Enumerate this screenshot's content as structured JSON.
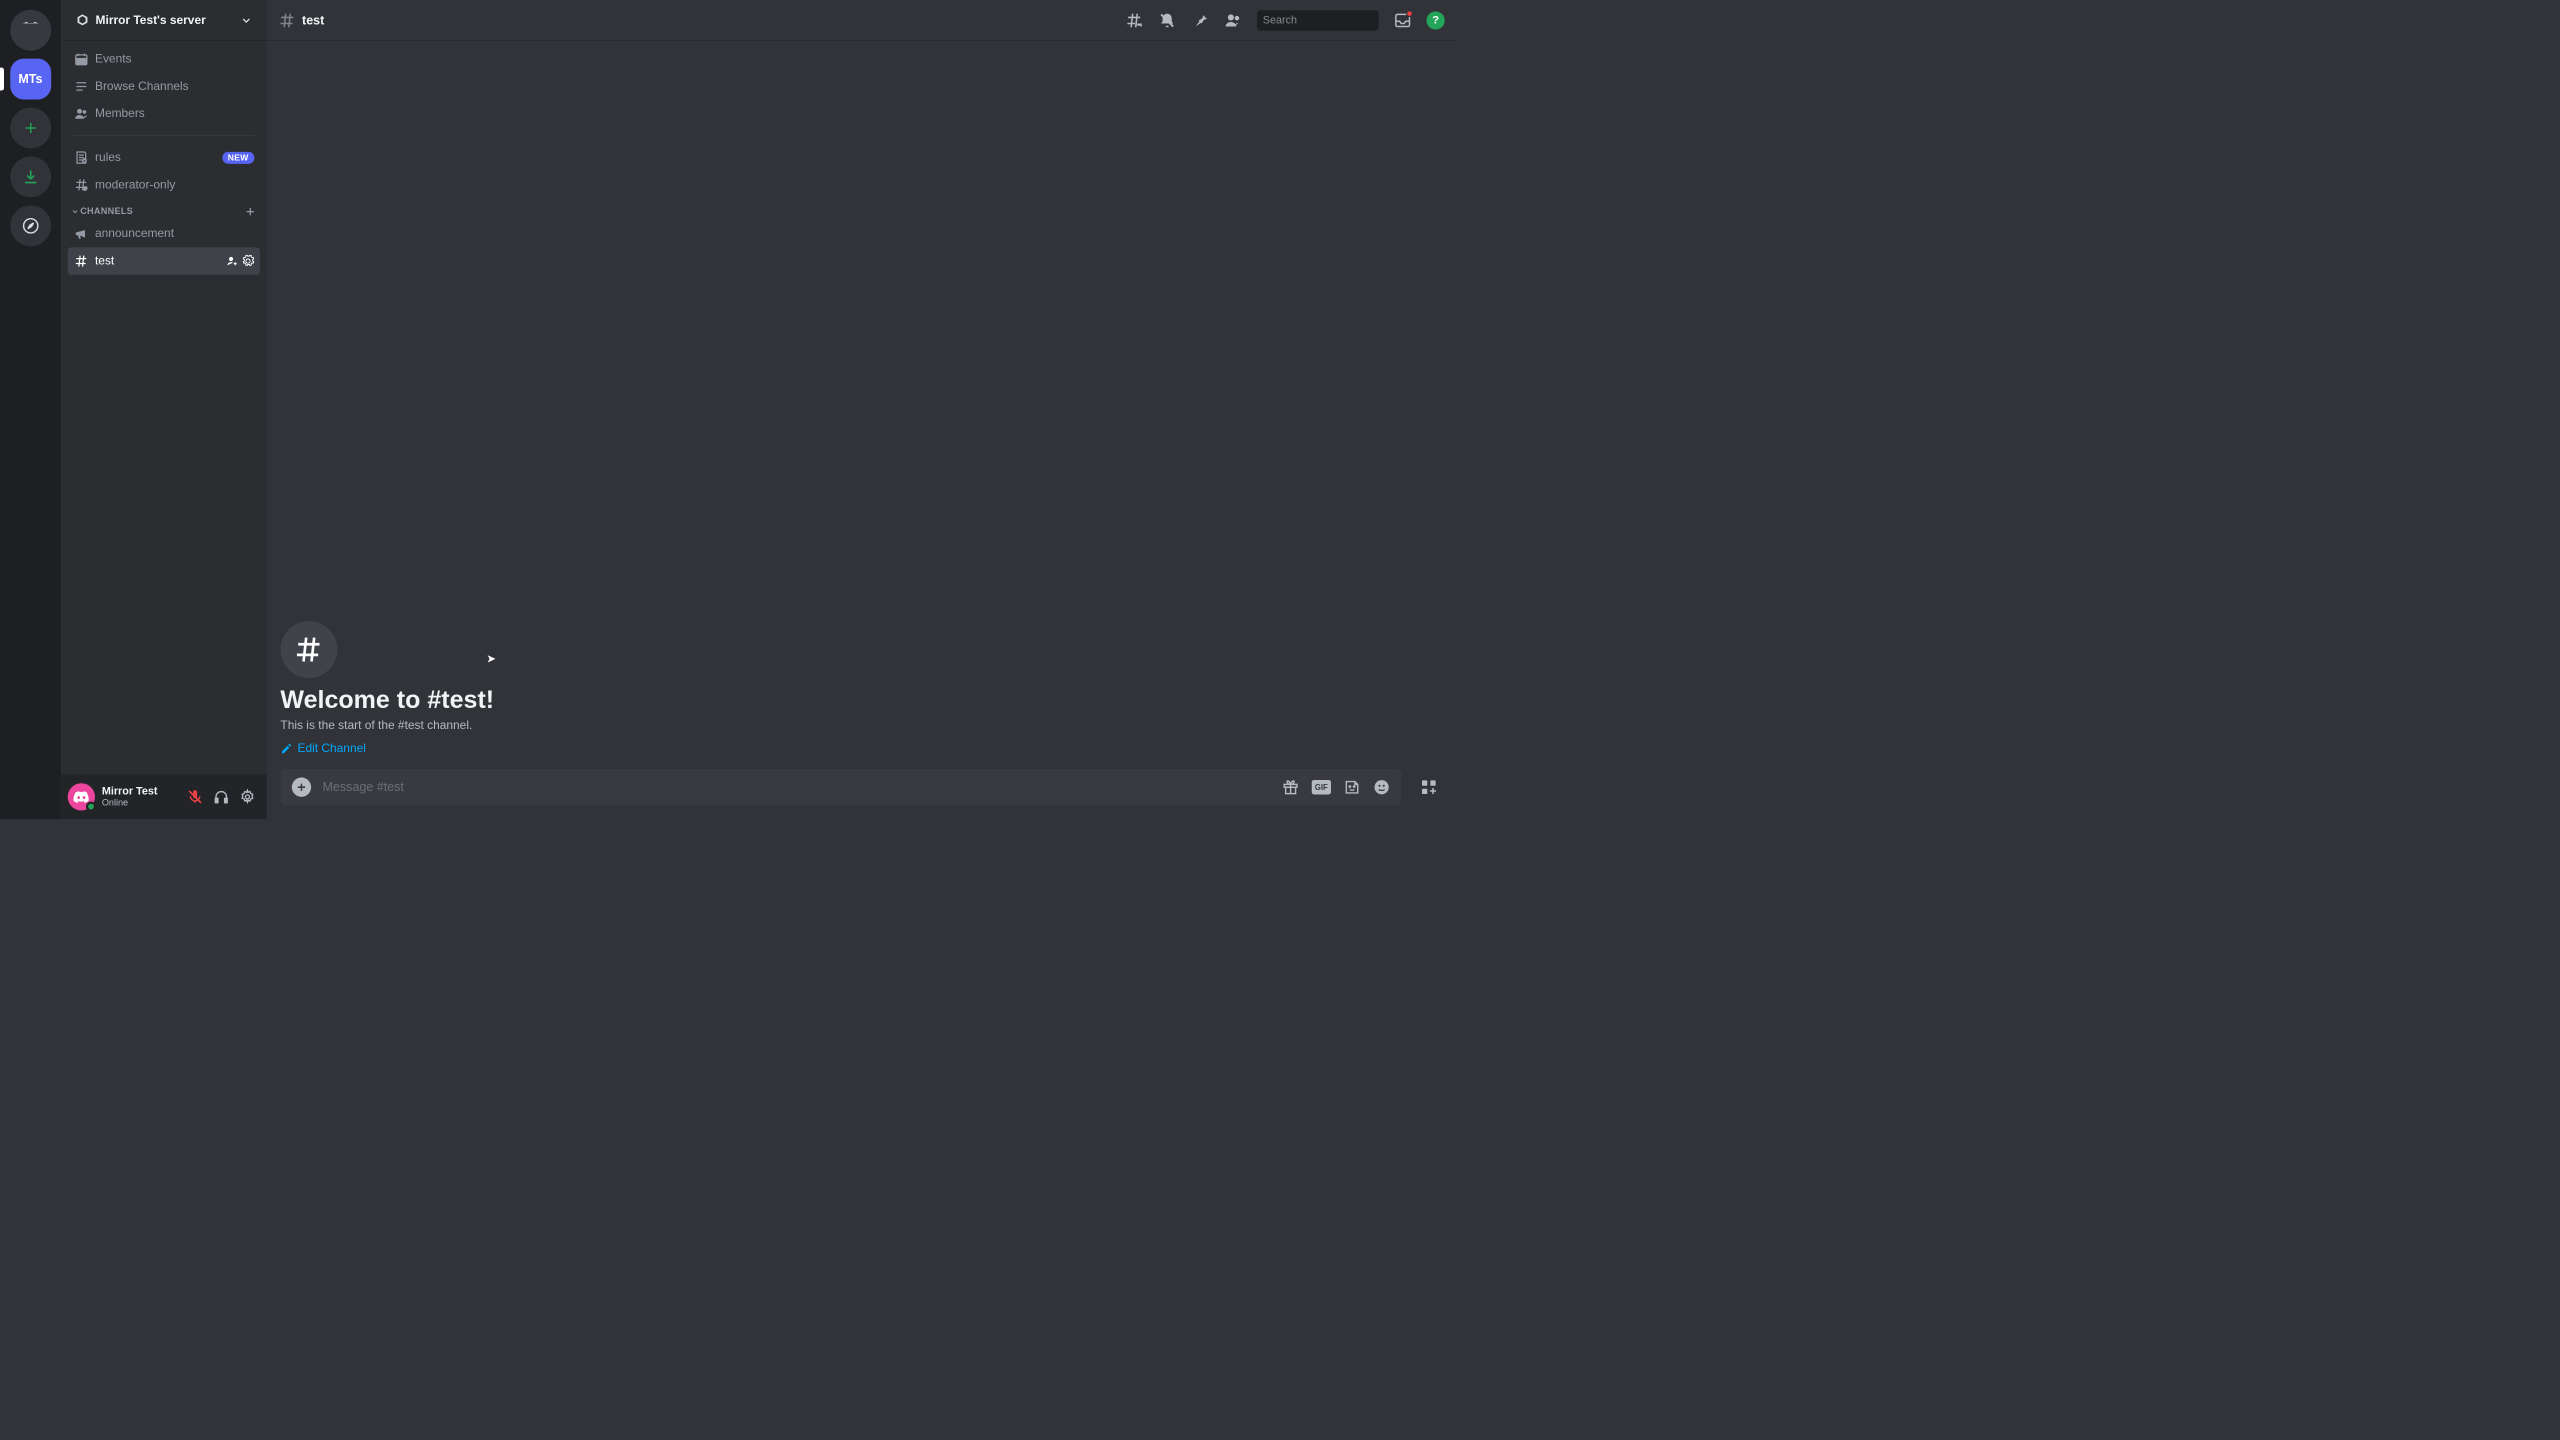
{
  "server": {
    "name": "Mirror Test's server",
    "abbrev": "MTs"
  },
  "nav": {
    "events": "Events",
    "browse": "Browse Channels",
    "members": "Members"
  },
  "top_channels": [
    {
      "name": "rules",
      "icon": "rules",
      "badge": "NEW"
    },
    {
      "name": "moderator-only",
      "icon": "hash-shield"
    }
  ],
  "category": {
    "label": "CHANNELS",
    "items": [
      {
        "name": "announcement",
        "icon": "megaphone",
        "selected": false
      },
      {
        "name": "test",
        "icon": "hash",
        "selected": true
      }
    ]
  },
  "user": {
    "name": "Mirror Test",
    "status": "Online"
  },
  "topbar": {
    "channel": "test",
    "search_placeholder": "Search"
  },
  "welcome": {
    "heading": "Welcome to #test!",
    "sub": "This is the start of the #test channel.",
    "edit": "Edit Channel"
  },
  "composer": {
    "placeholder": "Message #test"
  },
  "colors": {
    "blurple": "#5865f2",
    "green": "#23a559",
    "red": "#ed4245",
    "link": "#00a8fc"
  }
}
